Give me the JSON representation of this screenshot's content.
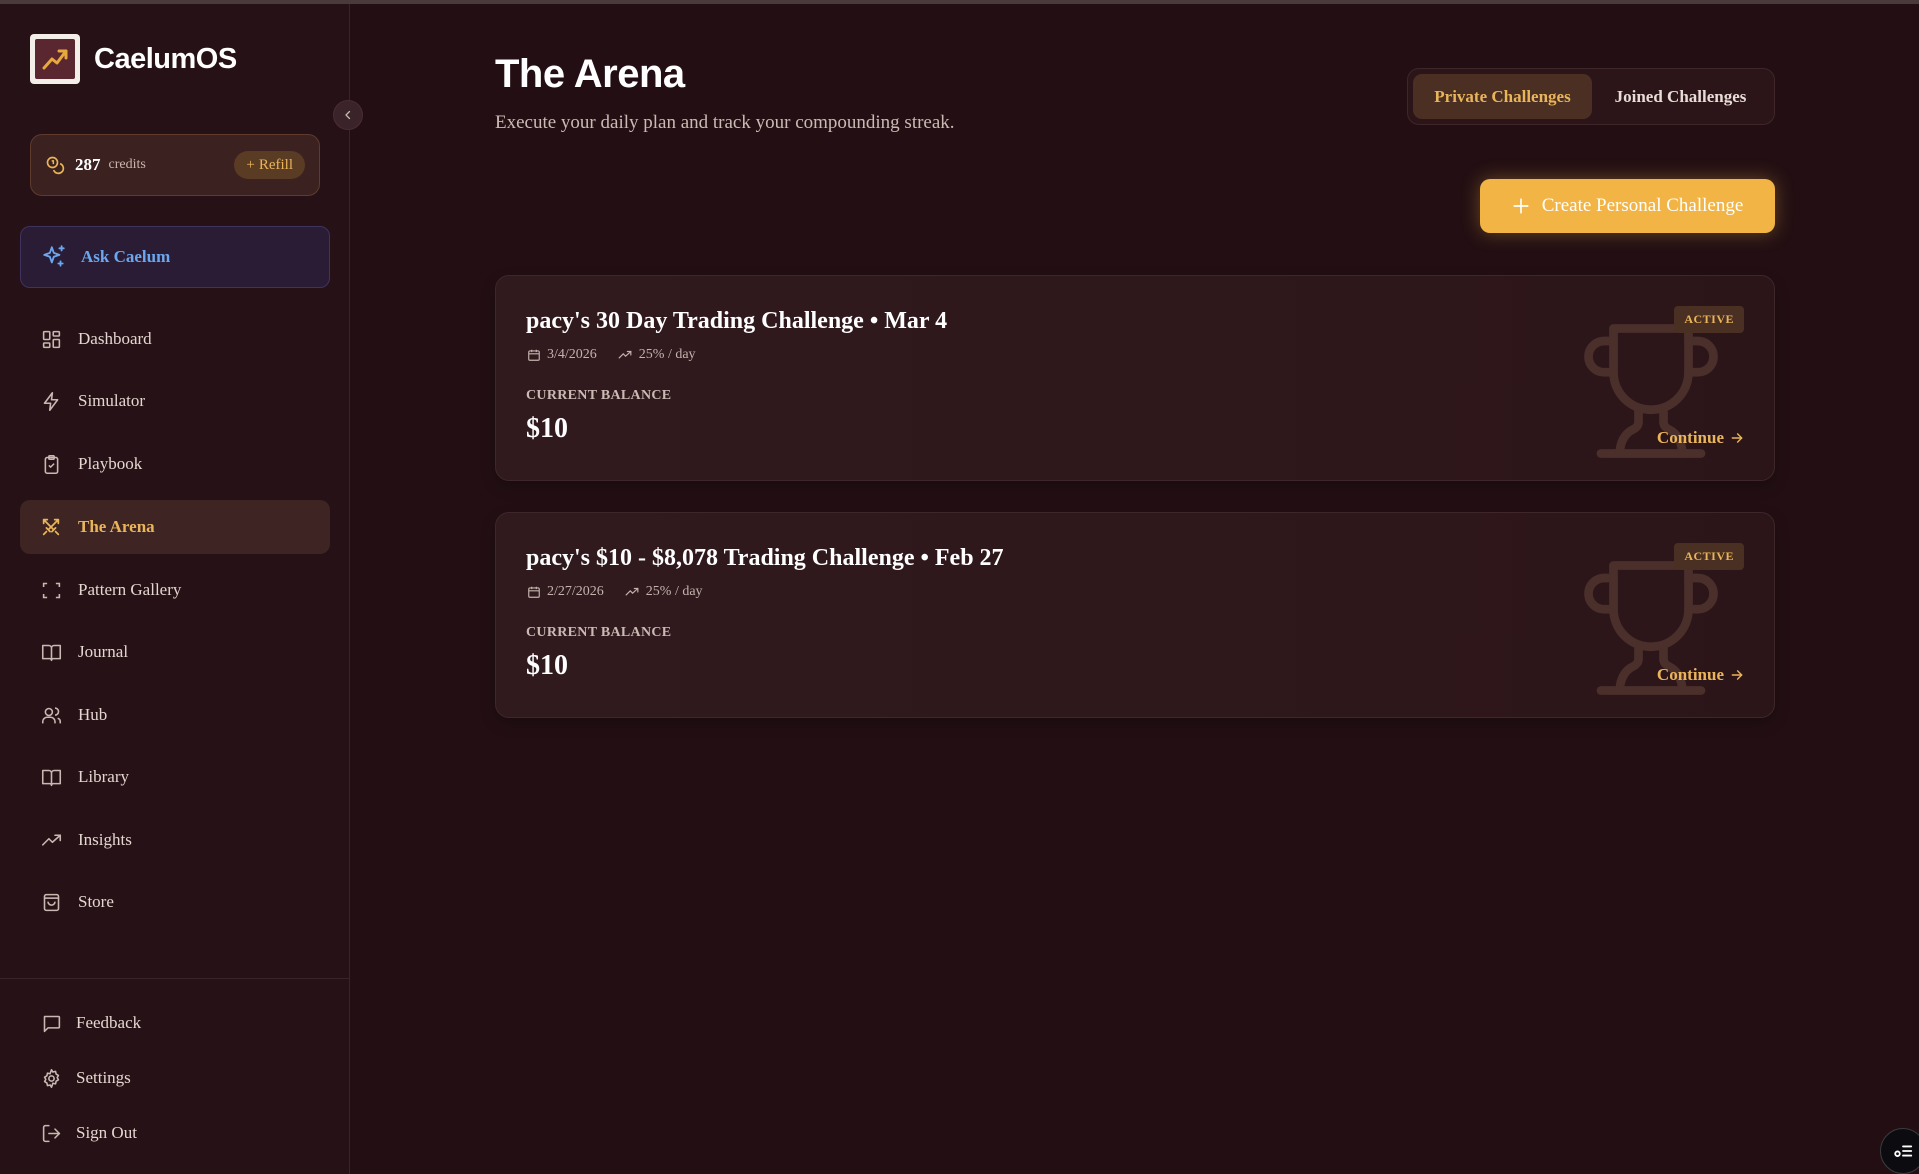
{
  "app": {
    "name": "CaelumOS"
  },
  "credits": {
    "count": "287",
    "label": "credits",
    "refill_label": "Refill"
  },
  "ask": {
    "label": "Ask Caelum"
  },
  "sidebar": {
    "items": [
      {
        "label": "Dashboard",
        "icon": "grid-icon"
      },
      {
        "label": "Simulator",
        "icon": "lightning-icon"
      },
      {
        "label": "Playbook",
        "icon": "clipboard-check-icon"
      },
      {
        "label": "The Arena",
        "icon": "crossed-swords-icon",
        "active": true
      },
      {
        "label": "Pattern Gallery",
        "icon": "scan-frame-icon"
      },
      {
        "label": "Journal",
        "icon": "book-open-icon"
      },
      {
        "label": "Hub",
        "icon": "users-icon"
      },
      {
        "label": "Library",
        "icon": "book-open-icon"
      },
      {
        "label": "Insights",
        "icon": "trending-up-icon"
      },
      {
        "label": "Store",
        "icon": "shopping-bag-icon"
      }
    ],
    "footer": [
      {
        "label": "Feedback",
        "icon": "message-square-icon"
      },
      {
        "label": "Settings",
        "icon": "gear-icon"
      },
      {
        "label": "Sign Out",
        "icon": "log-out-icon"
      }
    ]
  },
  "header": {
    "title": "The Arena",
    "subtitle": "Execute your daily plan and track your compounding streak."
  },
  "tabs": [
    {
      "label": "Private Challenges",
      "active": true
    },
    {
      "label": "Joined Challenges",
      "active": false
    }
  ],
  "create_button": {
    "label": "Create Personal Challenge"
  },
  "challenges": [
    {
      "title": "pacy's 30 Day Trading Challenge • Mar 4",
      "date": "3/4/2026",
      "rate": "25% / day",
      "balance_label": "CURRENT BALANCE",
      "balance": "$10",
      "status": "ACTIVE",
      "action": "Continue"
    },
    {
      "title": "pacy's $10 - $8,078 Trading Challenge • Feb 27",
      "date": "2/27/2026",
      "rate": "25% / day",
      "balance_label": "CURRENT BALANCE",
      "balance": "$10",
      "status": "ACTIVE",
      "action": "Continue"
    }
  ],
  "colors": {
    "background": "#230f13",
    "sidebar": "#261216",
    "accent": "#eab55a",
    "primary_button": "#f1b445",
    "ask_text": "#6ba7ee"
  }
}
